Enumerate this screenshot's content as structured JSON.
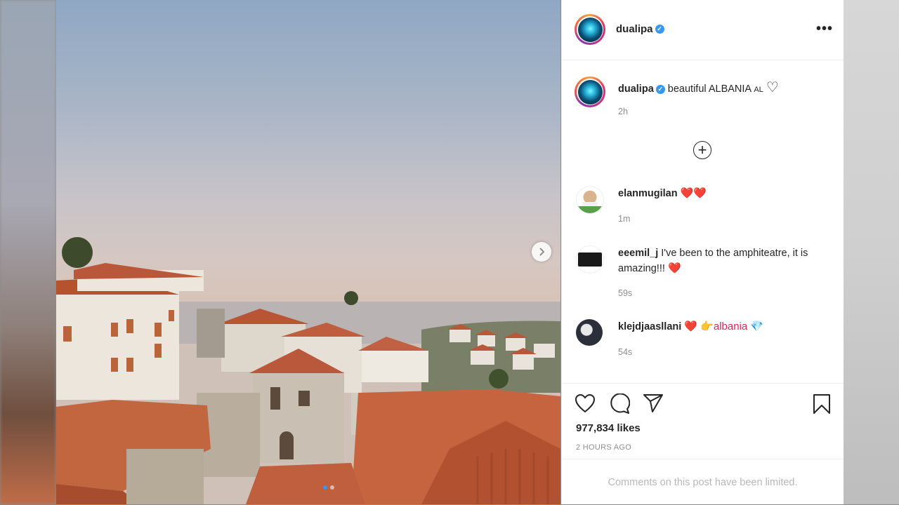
{
  "post": {
    "author": "dualipa",
    "verified_mark": "✓",
    "more_icon": "•••",
    "caption_text": "beautiful ALBANIA",
    "caption_flag": "AL",
    "caption_heart": "♡",
    "caption_time": "2h",
    "load_more_icon": "+",
    "likes": "977,834 likes",
    "time_ago": "2 HOURS AGO",
    "comments_limited": "Comments on this post have been limited.",
    "carousel": {
      "slides": 2,
      "active_slide": 1
    }
  },
  "comments": [
    {
      "user": "elanmugilan",
      "text": "",
      "emoji": "❤️❤️",
      "time": "1m"
    },
    {
      "user": "eeemil_j",
      "text": "I've been to the amphiteatre, it is amazing!!!",
      "emoji": "❤️",
      "time": "59s"
    },
    {
      "user": "klejdjaasllani",
      "text": "",
      "emoji": "❤️ 👉albania 💎",
      "time": "54s"
    }
  ],
  "icons": {
    "like": "heart-outline-icon",
    "comment": "comment-bubble-icon",
    "share": "paper-plane-icon",
    "save": "bookmark-icon",
    "next": "chevron-right-icon"
  },
  "colors": {
    "verified": "#3897f0",
    "heart": "#e0245e",
    "dot_active": "#3b95f0"
  }
}
